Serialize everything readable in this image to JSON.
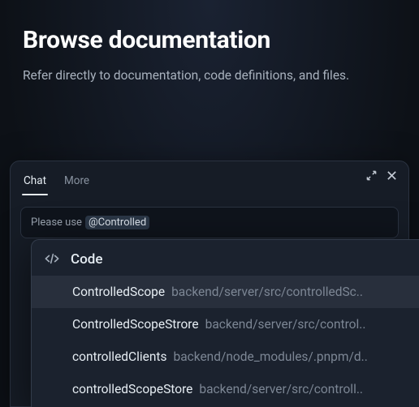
{
  "hero": {
    "title": "Browse documentation",
    "subtitle": "Refer directly to documentation, code definitions, and files."
  },
  "panel": {
    "tabs": [
      {
        "label": "Chat",
        "active": true
      },
      {
        "label": "More",
        "active": false
      }
    ],
    "input": {
      "prefix": "Please use ",
      "mention": "@Controlled"
    }
  },
  "dropdown": {
    "section_label": "Code",
    "results": [
      {
        "name": "ControlledScope",
        "path": "backend/server/src/controlledSc..",
        "selected": true
      },
      {
        "name": "ControlledScopeStrore",
        "path": "backend/server/src/control..",
        "selected": false
      },
      {
        "name": "controlledClients",
        "path": "backend/node_modules/.pnpm/d..",
        "selected": false
      },
      {
        "name": "controlledScopeStore",
        "path": "backend/server/src/controll..",
        "selected": false
      }
    ]
  }
}
